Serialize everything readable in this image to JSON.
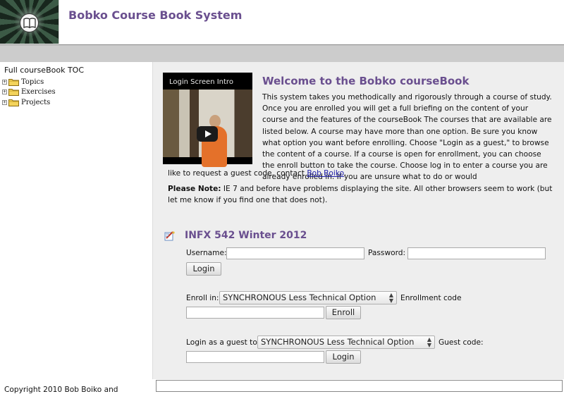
{
  "header": {
    "site_title": "Bobko Course Book System",
    "logo_icon": "book-icon"
  },
  "sidebar": {
    "title": "Full courseBook TOC",
    "items": [
      {
        "label": "Topics",
        "icon": "folder-icon"
      },
      {
        "label": "Exercises",
        "icon": "folder-icon"
      },
      {
        "label": "Projects",
        "icon": "folder-icon"
      }
    ]
  },
  "video": {
    "title": "Login Screen Intro",
    "play_icon": "play-icon"
  },
  "welcome": {
    "title": "Welcome to the Bobko courseBook",
    "text_part1": "This system takes you methodically and rigorously through a course of study. Once you are enrolled you will get a full briefing on the content of your course and the features of the courseBook The courses that are available are listed below. A course may have more than one option. Be sure you know what option you want before enrolling. Choose \"Login as a guest,\" to browse the content of a course. If a course is open for enrollment, you can choose the enroll button to take the course. Choose log in to enter a course you are already enrolled in. If you are unsure what to do or would",
    "text_part2": "like to request a guest code. contact ",
    "contact_link": "Bob Boiko",
    "text_end": ".",
    "note_label": "Please Note:",
    "note_text": " IE 7 and before have problems displaying the site. All other browsers seem to work (but let me know if you find one that does not)."
  },
  "course": {
    "title": "INFX 542 Winter 2012",
    "username_label": "Username:",
    "username_value": "",
    "password_label": "Password:",
    "password_value": "",
    "login_button": "Login",
    "enroll_label": "Enroll in:",
    "enroll_option": "SYNCHRONOUS Less Technical Option",
    "enrollment_code_label": "Enrollment code",
    "enrollment_code_value": "",
    "enroll_button": "Enroll",
    "guest_label": "Login as a guest to:",
    "guest_option": "SYNCHRONOUS Less Technical Option",
    "guest_code_label": "Guest code:",
    "guest_code_value": "",
    "guest_login_button": "Login"
  },
  "footer": {
    "copyright": "Copyright 2010 Bob Boiko and"
  },
  "colors": {
    "title_purple": "#6a4f8f",
    "main_bg": "#eeeeee",
    "topbar_bg": "#cccccc",
    "link": "#1a1aa6"
  }
}
